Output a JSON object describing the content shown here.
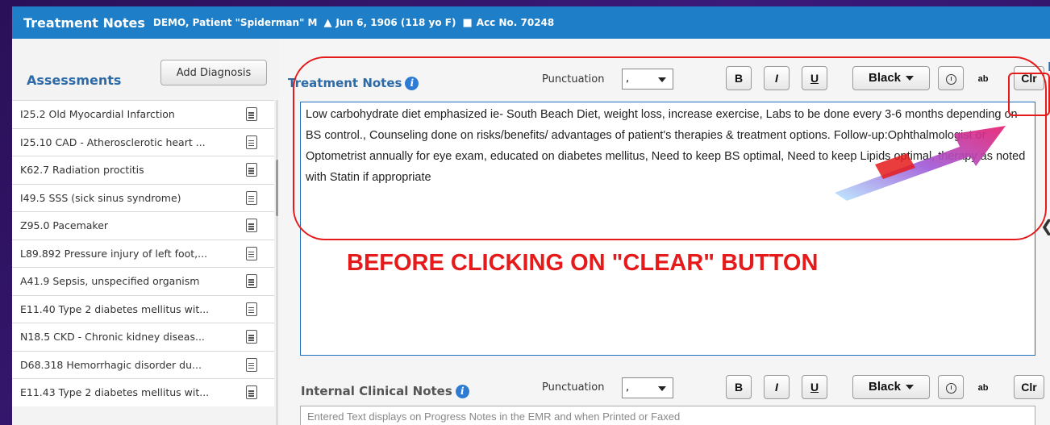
{
  "titlebar": {
    "title": "Treatment Notes",
    "patient": "DEMO, Patient \"Spiderman\" M",
    "dob": "Jun 6, 1906 (118 yo F)",
    "acc": "Acc No. 70248"
  },
  "assessments": {
    "title": "Assessments",
    "add_button": "Add Diagnosis",
    "items": [
      "I25.2 Old Myocardial Infarction",
      "I25.10 CAD - Atherosclerotic heart ...",
      "K62.7 Radiation proctitis",
      "I49.5 SSS (sick sinus syndrome)",
      "Z95.0 Pacemaker",
      "L89.892 Pressure injury of left foot,...",
      "A41.9 Sepsis, unspecified organism",
      "E11.40 Type 2 diabetes mellitus wit...",
      "N18.5 CKD - Chronic kidney diseas...",
      "D68.318 Hemorrhagic disorder du...",
      "E11.43 Type 2 diabetes mellitus wit..."
    ]
  },
  "treatment_notes": {
    "title": "Treatment Notes",
    "punctuation_label": "Punctuation",
    "punctuation_value": ",",
    "bold": "B",
    "italic": "I",
    "underline": "U",
    "color": "Black",
    "spell": "ab",
    "clear": "Clr",
    "text": "Low carbohydrate diet emphasized ie- South Beach Diet, weight loss, increase exercise, Labs to be done every 3-6 months depending on BS control., Counseling done on risks/benefits/ advantages of patient's therapies & treatment options. Follow-up:Ophthalmologist or Optometrist annually for eye exam, educated on diabetes mellitus, Need to keep BS optimal, Need to keep Lipids optimal, therapy as noted with Statin if appropriate"
  },
  "internal_notes": {
    "title": "Internal Clinical Notes",
    "punctuation_label": "Punctuation",
    "punctuation_value": ",",
    "bold": "B",
    "italic": "I",
    "underline": "U",
    "color": "Black",
    "spell": "ab",
    "clear": "Clr",
    "placeholder": "Entered Text displays on Progress Notes in the EMR and when Printed or Faxed"
  },
  "annotation": {
    "label": "BEFORE CLICKING ON \"CLEAR\" BUTTON",
    "color": "#e51b1b"
  },
  "edge_letter": "K",
  "colors": {
    "titlebar": "#1e7fc8",
    "accent": "#2d6aa6",
    "background": "#2a1058"
  }
}
